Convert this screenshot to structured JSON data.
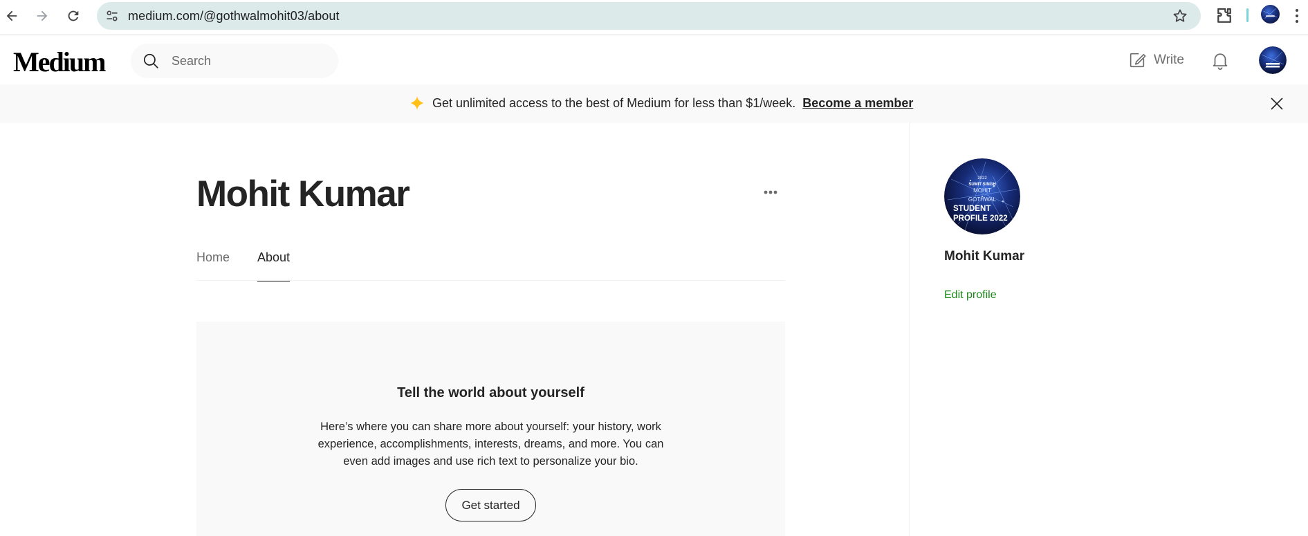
{
  "browser": {
    "url": "medium.com/@gothwalmohit03/about",
    "icons": [
      "back-arrow-icon",
      "forward-arrow-icon",
      "reload-icon",
      "site-settings-icon",
      "star-icon",
      "extensions-icon",
      "menu-dots-icon"
    ]
  },
  "header": {
    "logo": "Medium",
    "search_placeholder": "Search",
    "write_label": "Write"
  },
  "banner": {
    "text": "Get unlimited access to the best of Medium for less than $1/week.",
    "link": "Become a member",
    "accent_color": "#ffc017"
  },
  "profile": {
    "name": "Mohit Kumar",
    "tabs": [
      {
        "label": "Home",
        "active": false
      },
      {
        "label": "About",
        "active": true
      }
    ],
    "about_card": {
      "title": "Tell the world about yourself",
      "text": "Here’s where you can share more about yourself: your history, work experience, accomplishments, interests, dreams, and more. You can even add images and use rich text to personalize your bio.",
      "button": "Get started"
    }
  },
  "sidebar": {
    "name": "Mohit Kumar",
    "edit_label": "Edit profile",
    "edit_color": "#1a8917"
  },
  "avatar_text": {
    "line1": "2022",
    "line2": "SUMIT SINGH",
    "line3": "MOHIT",
    "line4": "GOTHWAL",
    "line5": "STUDENT",
    "line6": "PROFILE 2022"
  }
}
